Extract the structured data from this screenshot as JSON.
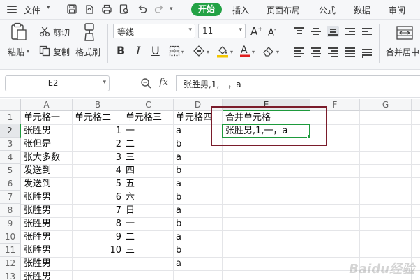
{
  "menubar": {
    "file_label": "文件",
    "tabs": [
      "开始",
      "插入",
      "页面布局",
      "公式",
      "数据",
      "审阅"
    ],
    "active_tab": "开始",
    "accent_color": "#23a245"
  },
  "ribbon": {
    "paste_label": "粘贴",
    "cut_label": "剪切",
    "copy_label": "复制",
    "format_painter_label": "格式刷",
    "font_name": "等线",
    "font_size": "11",
    "bold_label": "B",
    "italic_label": "I",
    "underline_label": "U",
    "merge_center_label": "合并居中"
  },
  "formula_bar": {
    "name_box": "E2",
    "fx_label": "fx",
    "formula": "张胜男,1,一，a"
  },
  "sheet": {
    "columns": [
      "A",
      "B",
      "C",
      "D",
      "E",
      "F",
      "G"
    ],
    "selected_column": "E",
    "selected_row": "2",
    "rows": [
      {
        "n": "1",
        "a": "单元格一",
        "b": "单元格二",
        "c": "单元格三",
        "d": "单元格四",
        "e": "合并单元格"
      },
      {
        "n": "2",
        "a": "张胜男",
        "b": "1",
        "c": "一",
        "d": "a",
        "e": "张胜男,1,一，a"
      },
      {
        "n": "3",
        "a": "张但是",
        "b": "2",
        "c": "二",
        "d": "b",
        "e": ""
      },
      {
        "n": "4",
        "a": "张大多数",
        "b": "3",
        "c": "三",
        "d": "a",
        "e": ""
      },
      {
        "n": "5",
        "a": "发送到",
        "b": "4",
        "c": "四",
        "d": "b",
        "e": ""
      },
      {
        "n": "6",
        "a": "发送到",
        "b": "5",
        "c": "五",
        "d": "a",
        "e": ""
      },
      {
        "n": "7",
        "a": "张胜男",
        "b": "6",
        "c": "六",
        "d": "b",
        "e": ""
      },
      {
        "n": "8",
        "a": "张胜男",
        "b": "7",
        "c": "日",
        "d": "a",
        "e": ""
      },
      {
        "n": "9",
        "a": "张胜男",
        "b": "8",
        "c": "一",
        "d": "b",
        "e": ""
      },
      {
        "n": "10",
        "a": "张胜男",
        "b": "9",
        "c": "二",
        "d": "a",
        "e": ""
      },
      {
        "n": "11",
        "a": "张胜男",
        "b": "10",
        "c": "三",
        "d": "b",
        "e": ""
      },
      {
        "n": "12",
        "a": "张胜男",
        "b": "",
        "c": "",
        "d": "a",
        "e": ""
      },
      {
        "n": "13",
        "a": "张胜男",
        "b": "",
        "c": "",
        "d": "",
        "e": ""
      }
    ]
  },
  "watermark": "Baidu经验"
}
